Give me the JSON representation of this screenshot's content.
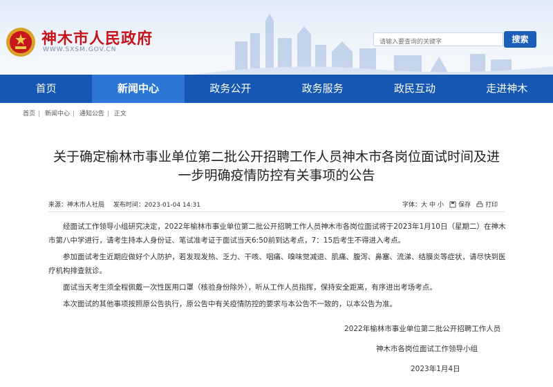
{
  "header": {
    "site_name": "神木市人民政府",
    "site_url": "WWW.SXSM.GOV.CN",
    "search_placeholder": "请输入要查询的关键字",
    "search_button": "搜索"
  },
  "nav": {
    "items": [
      {
        "label": "首页"
      },
      {
        "label": "新闻中心"
      },
      {
        "label": "政务公开"
      },
      {
        "label": "政务服务"
      },
      {
        "label": "政民互动"
      },
      {
        "label": "走进神木"
      }
    ],
    "active_index": 1
  },
  "breadcrumb": [
    "首页",
    "新闻中心",
    "通知公告",
    "正文"
  ],
  "article": {
    "title_line1": "关于确定榆林市事业单位第二批公开招聘工作人员神木市各岗位面试时间及进",
    "title_line2": "一步明确疫情防控有关事项的公告",
    "source": "来源：神木市人社局",
    "publish_time": "发布时间：2023-01-04 14:31",
    "font_size_label": "字体：",
    "font_big": "大",
    "font_mid": "中",
    "font_small": "小",
    "save_label": "保存",
    "print_label": "打印",
    "paragraphs": [
      "经面试工作领导小组研究决定，2022年榆林市事业单位第二批公开招聘工作人员神木市各岗位面试将于2023年1月10日（星期二）在神木市第八中学进行，请考生持本人身份证、笔试准考证于面试当天6:50前到达考点，7：15后考生不得进入考点。",
      "参加面试考生近期应做好个人防护，若发现发热、乏力、干咳、咽痛、嗅味觉减退、肌痛、腹泻、鼻塞、流涕、结膜炎等症状，请尽快到医疗机构排查就诊。",
      "面试当天考生须全程佩戴一次性医用口罩（核验身份除外），听从工作人员指挥，保持安全距离，有序进出考场考点。",
      "本次面试的其他事项按照原公告执行，原公告中有关疫情防控的要求与本公告不一致的，以本公告为准。"
    ],
    "signature_line1": "2022年榆林市事业单位第二批公开招聘工作人员",
    "signature_line2": "神木市各岗位面试工作领导小组",
    "signature_date": "2023年1月4日"
  },
  "colors": {
    "brand_red": "#c6121a",
    "nav_blue": "#1657b4",
    "nav_active": "#2c77d6"
  }
}
